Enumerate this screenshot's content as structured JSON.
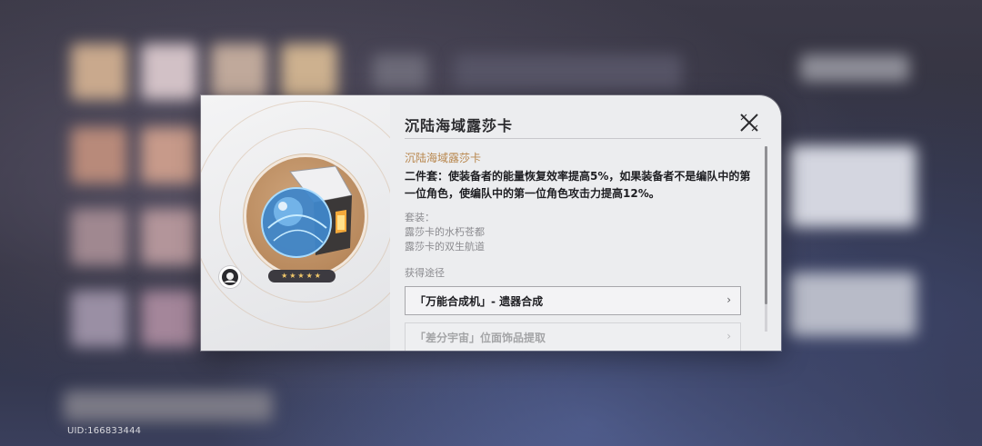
{
  "footer": {
    "uid": "UID:166833444"
  },
  "dialog": {
    "title": "沉陆海域露莎卡",
    "close_icon": "close-x-icon",
    "rarity_stars": "★★★★★",
    "set_name": "沉陆海域露莎卡",
    "effect": "二件套：使装备者的能量恢复效率提高5%，如果装备者不是编队中的第一位角色，使编队中的第一位角色攻击力提高12%。",
    "set_label": "套装：",
    "set_items": [
      "露莎卡的水朽苍都",
      "露莎卡的双生航道"
    ],
    "acquire_label": "获得途径",
    "acquire_routes": [
      {
        "label": "「万能合成机」- 遗器合成",
        "arrow": "›"
      },
      {
        "label": "「差分宇宙」位面饰品提取",
        "arrow": "›"
      }
    ]
  },
  "colors": {
    "accent_gold": "#b8874e",
    "panel_bg": "#ecedef",
    "star": "#f2c96a"
  }
}
